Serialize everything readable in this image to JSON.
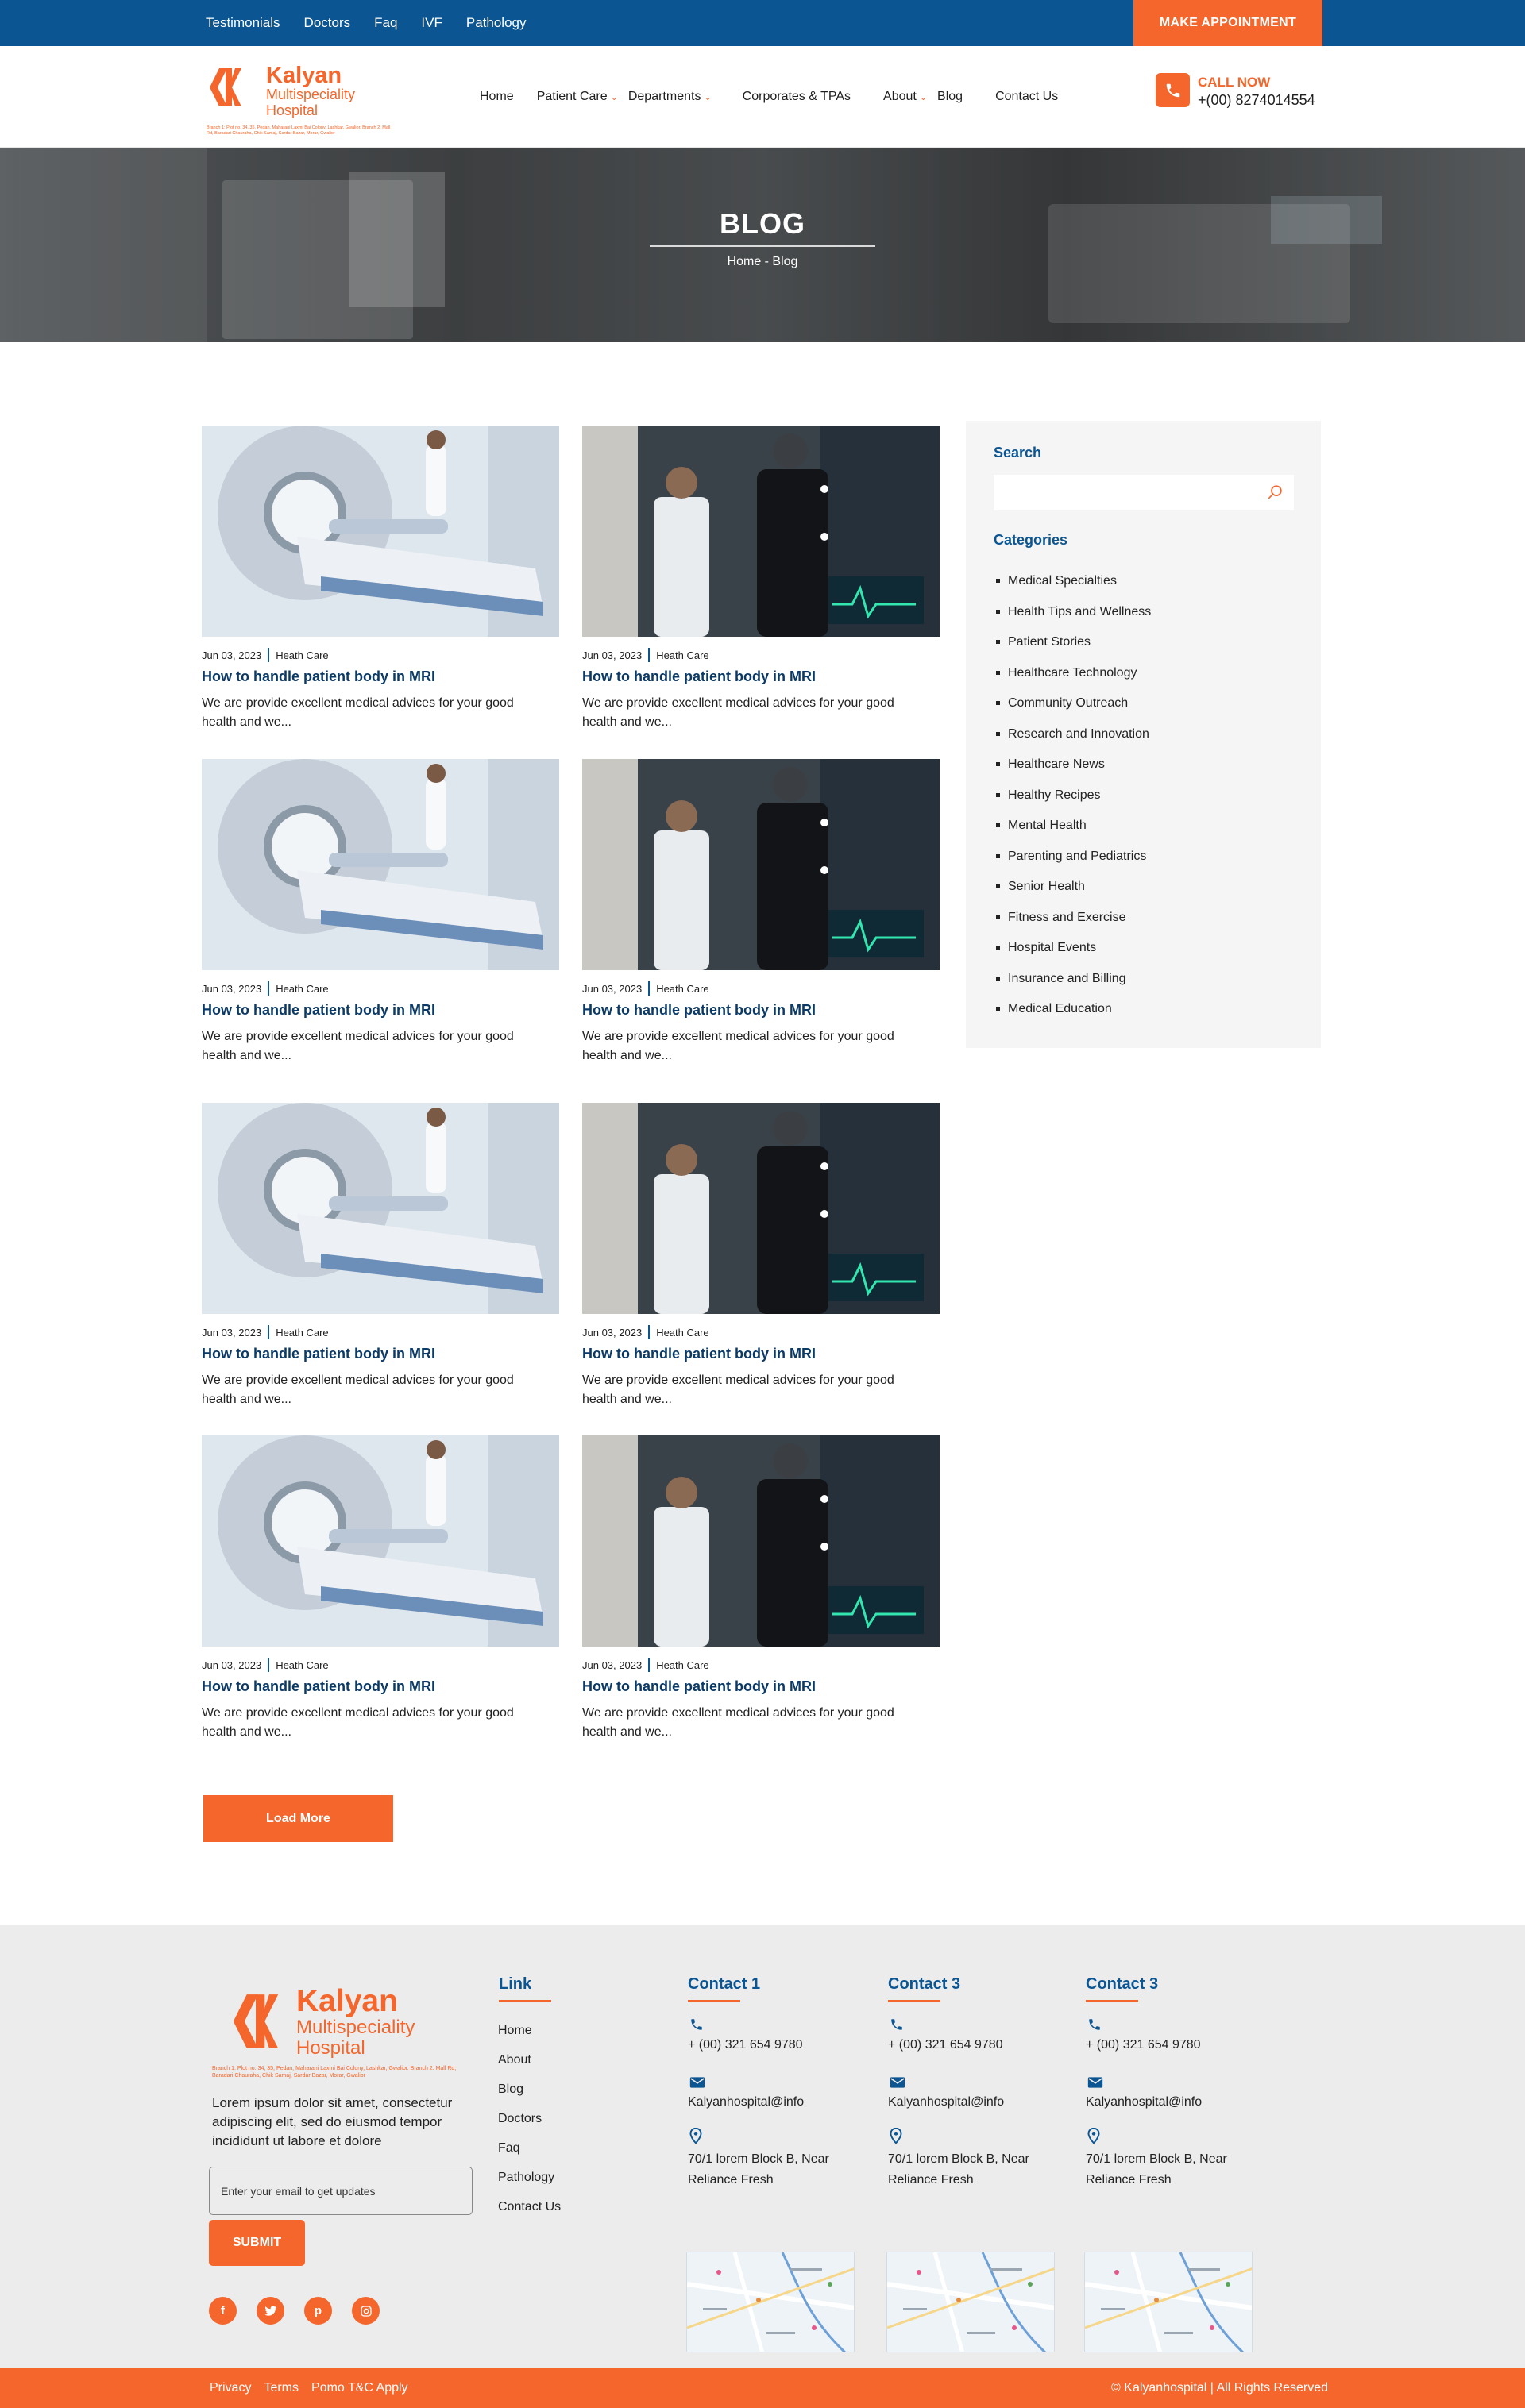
{
  "topbar": {
    "links": [
      "Testimonials",
      "Doctors",
      "Faq",
      "IVF",
      "Pathology"
    ],
    "appointment_label": "MAKE APPOINTMENT"
  },
  "brand": {
    "name": "Kalyan",
    "subtitle_line1": "Multispeciality",
    "subtitle_line2": "Hospital",
    "address": "Branch 1: Plot no. 34, 35, Pedan, Maharani Laxmi Bai Colony, Lashkar, Gwalior. Branch 2: Mall Rd, Baradari Chauraha, Chik Samaj, Sardar Bazar, Morar, Gwalior"
  },
  "nav": {
    "items": [
      {
        "label": "Home",
        "dropdown": false
      },
      {
        "label": "Patient Care",
        "dropdown": true
      },
      {
        "label": "Departments",
        "dropdown": true
      },
      {
        "label": "Corporates & TPAs",
        "dropdown": false
      },
      {
        "label": "About",
        "dropdown": true
      },
      {
        "label": "Blog",
        "dropdown": false
      },
      {
        "label": "Contact Us",
        "dropdown": false
      }
    ],
    "call_label": "CALL NOW",
    "call_number": "+(00) 8274014554"
  },
  "hero": {
    "title": "BLOG",
    "breadcrumb": "Home - Blog"
  },
  "posts": [
    {
      "date": "Jun 03, 2023",
      "category": "Heath Care",
      "title": "How to handle patient body in MRI",
      "excerpt": "We are provide excellent medical advices for your good health and we...",
      "image": "mri"
    },
    {
      "date": "Jun 03, 2023",
      "category": "Heath Care",
      "title": "How to handle patient body in MRI",
      "excerpt": "We are provide excellent medical advices for your good health and we...",
      "image": "treadmill"
    },
    {
      "date": "Jun 03, 2023",
      "category": "Heath Care",
      "title": "How to handle patient body in MRI",
      "excerpt": "We are provide excellent medical advices for your good health and we...",
      "image": "mri"
    },
    {
      "date": "Jun 03, 2023",
      "category": "Heath Care",
      "title": "How to handle patient body in MRI",
      "excerpt": "We are provide excellent medical advices for your good health and we...",
      "image": "treadmill"
    },
    {
      "date": "Jun 03, 2023",
      "category": "Heath Care",
      "title": "How to handle patient body in MRI",
      "excerpt": "We are provide excellent medical advices for your good health and we...",
      "image": "mri"
    },
    {
      "date": "Jun 03, 2023",
      "category": "Heath Care",
      "title": "How to handle patient body in MRI",
      "excerpt": "We are provide excellent medical advices for your good health and we...",
      "image": "treadmill"
    },
    {
      "date": "Jun 03, 2023",
      "category": "Heath Care",
      "title": "How to handle patient body in MRI",
      "excerpt": "We are provide excellent medical advices for your good health and we...",
      "image": "mri"
    },
    {
      "date": "Jun 03, 2023",
      "category": "Heath Care",
      "title": "How to handle patient body in MRI",
      "excerpt": "We are provide excellent medical advices for your good health and we...",
      "image": "treadmill"
    }
  ],
  "load_more_label": "Load More",
  "sidebar": {
    "search_heading": "Search",
    "search_value": "",
    "categories_heading": "Categories",
    "categories": [
      "Medical Specialties",
      "Health Tips and Wellness",
      "Patient Stories",
      "Healthcare Technology",
      "Community Outreach",
      "Research and Innovation",
      "Healthcare News",
      "Healthy Recipes",
      "Mental Health",
      "Parenting and Pediatrics",
      "Senior Health",
      "Fitness and Exercise",
      "Hospital Events",
      "Insurance and Billing",
      "Medical Education"
    ]
  },
  "footer": {
    "description": "Lorem ipsum dolor sit amet, consectetur adipiscing elit, sed do eiusmod tempor incididunt ut labore et dolore",
    "email_placeholder": "Enter your email to get updates",
    "submit_label": "SUBMIT",
    "socials": [
      "facebook-icon",
      "twitter-icon",
      "pinterest-icon",
      "instagram-icon"
    ],
    "links_heading": "Link",
    "links": [
      "Home",
      "About",
      "Blog",
      "Doctors",
      "Faq",
      "Pathology",
      "Contact Us"
    ],
    "contacts": [
      {
        "heading": "Contact 1",
        "phone": "+ (00) 321 654 9780",
        "email": "Kalyanhospital@info",
        "address": "70/1 lorem Block B, Near Reliance Fresh"
      },
      {
        "heading": "Contact 3",
        "phone": "+ (00) 321 654 9780",
        "email": "Kalyanhospital@info",
        "address": "70/1 lorem Block B, Near Reliance Fresh"
      },
      {
        "heading": "Contact 3",
        "phone": "+ (00) 321 654 9780",
        "email": "Kalyanhospital@info",
        "address": "70/1 lorem Block B, Near Reliance Fresh"
      }
    ]
  },
  "bottombar": {
    "links": [
      "Privacy",
      "Terms",
      "Pomo T&C Apply"
    ],
    "copyright": "© Kalyanhospital | All Rights Reserved"
  },
  "colors": {
    "primary_blue": "#0a5592",
    "accent_orange": "#f4662b",
    "title_navy": "#0b3a66"
  }
}
